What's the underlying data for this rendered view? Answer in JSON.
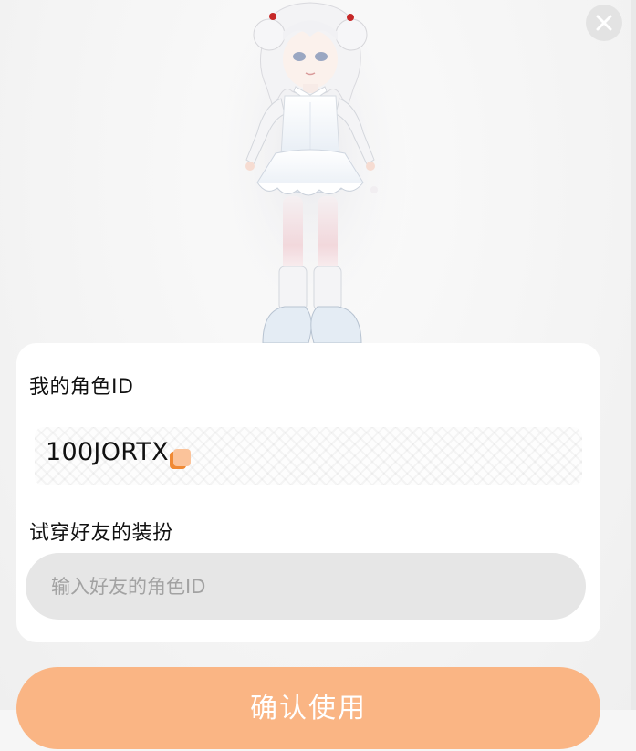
{
  "dialog": {
    "close_icon": "close-icon",
    "avatar_icon": "avatar-character-image"
  },
  "my_role": {
    "label": "我的角色ID",
    "id_value": "100JORTX",
    "copy_icon": "copy-icon"
  },
  "try_on": {
    "label": "试穿好友的装扮",
    "input_placeholder": "输入好友的角色ID",
    "input_value": ""
  },
  "confirm_button": {
    "label": "确认使用"
  },
  "colors": {
    "accent": "#fab584",
    "copy_icon_back": "#f08a35",
    "copy_icon_front": "#fbc39a",
    "input_bg": "#e6e6e6",
    "card_bg": "#ffffff",
    "page_bg": "#f6f6f6"
  }
}
